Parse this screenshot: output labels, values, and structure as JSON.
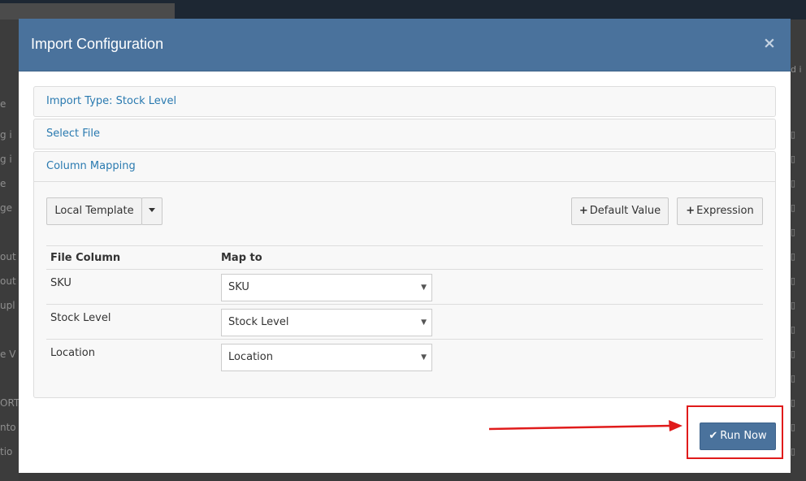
{
  "background": {
    "left_texts": [
      "e",
      "g i",
      "g i",
      "e",
      "ge",
      "out",
      "out",
      "upl",
      "e V",
      "ORT",
      "nto",
      "tio"
    ],
    "right_text": "d i",
    "doc_icon": "doc-icon"
  },
  "modal": {
    "title": "Import Configuration",
    "close_glyph": "×",
    "sections": {
      "import_type": "Import Type: Stock Level",
      "select_file": "Select File",
      "column_mapping": "Column Mapping"
    },
    "toolbar": {
      "local_template": "Local Template",
      "default_value": "Default Value",
      "expression": "Expression"
    },
    "table": {
      "headers": [
        "File Column",
        "Map to"
      ],
      "rows": [
        {
          "file_column": "SKU",
          "map_to": "SKU"
        },
        {
          "file_column": "Stock Level",
          "map_to": "Stock Level"
        },
        {
          "file_column": "Location",
          "map_to": "Location"
        }
      ]
    },
    "run_now": "Run Now"
  },
  "colors": {
    "header": "#4a729c",
    "link": "#2a7ab0",
    "annotation": "#e01b1b"
  }
}
